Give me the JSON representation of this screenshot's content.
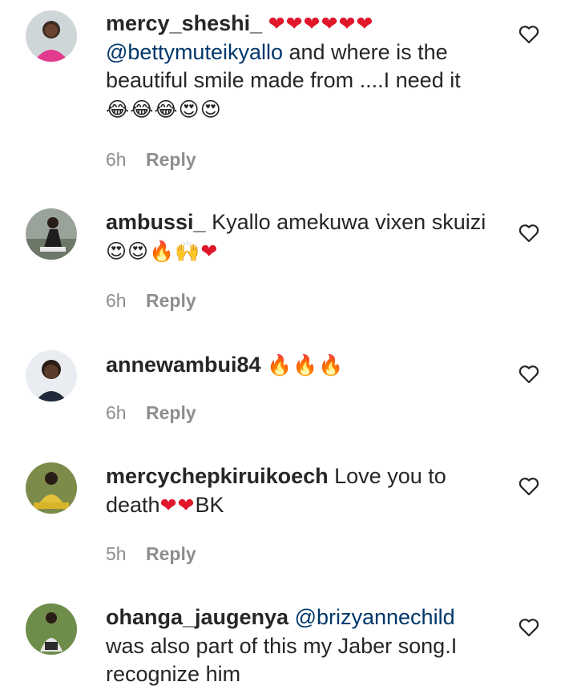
{
  "comments": [
    {
      "username": "mercy_sheshi_",
      "mention": "",
      "text_before": " ",
      "emoji_hearts": "❤❤❤❤❤❤",
      "mention2": "@bettymuteikyallo",
      "text": " and where is the beautiful smile made from ....I need it",
      "emoji": "😂😂😂😍😍",
      "time": "6h",
      "reply_label": "Reply"
    },
    {
      "username": "ambussi_",
      "text": " Kyallo amekuwa vixen skuizi",
      "emoji": "😍😍🔥🙌",
      "emoji_heart": "❤",
      "time": "6h",
      "reply_label": "Reply"
    },
    {
      "username": "annewambui84",
      "emoji": "🔥🔥🔥",
      "time": "6h",
      "reply_label": "Reply"
    },
    {
      "username": "mercychepkiruikoech",
      "text": " Love you to death",
      "emoji_hearts": "❤❤",
      "text_after": "BK",
      "time": "5h",
      "reply_label": "Reply"
    },
    {
      "username": "ohanga_jaugenya",
      "mention": " @brizyannechild",
      "text": " was also part of this my Jaber song.I recognize him",
      "time": "",
      "reply_label": ""
    }
  ],
  "icons": {
    "like": "heart-outline-icon",
    "avatar": "user-avatar"
  },
  "colors": {
    "mention": "#00376b",
    "meta": "#8e8e8e",
    "heart": "#e0172b"
  }
}
